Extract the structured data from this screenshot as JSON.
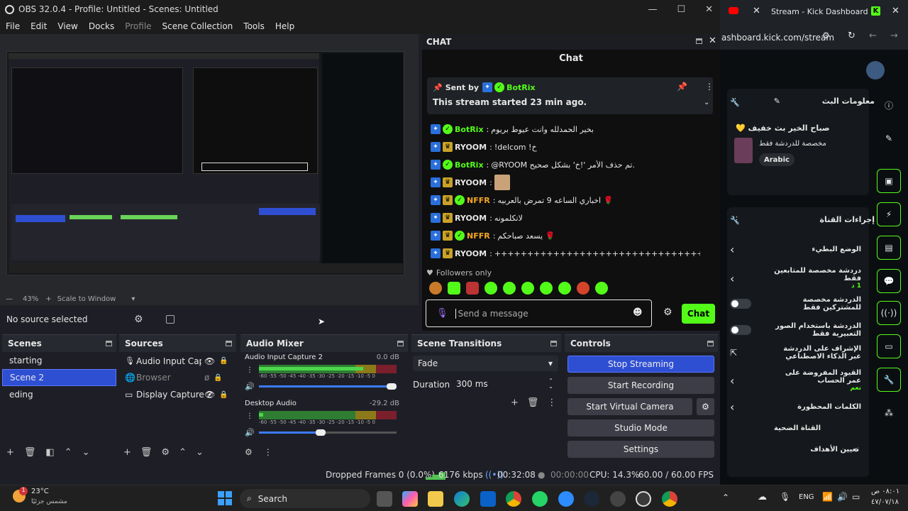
{
  "obs": {
    "title": "OBS 32.0.4 - Profile: Untitled - Scenes: Untitled",
    "menu": [
      "File",
      "Edit",
      "View",
      "Docks",
      "Profile",
      "Scene Collection",
      "Tools",
      "Help"
    ],
    "zoom": "43%",
    "scale_mode": "Scale to Window",
    "no_source": "No source selected",
    "scenes": {
      "title": "Scenes",
      "items": [
        "starting",
        "Scene 2",
        "eding"
      ],
      "selected_index": 1
    },
    "sources": {
      "title": "Sources",
      "items": [
        "Audio Input Captu",
        "Browser",
        "Display Capture 2"
      ]
    },
    "mixer": {
      "title": "Audio Mixer",
      "channels": [
        {
          "name": "Audio Input Capture 2",
          "db": "0.0 dB",
          "ticks": "-60 -55 -50 -45 -40 -35 -30 -25 -20 -15 -10 -5 0",
          "volume": 1.0
        },
        {
          "name": "Desktop Audio",
          "db": "-29.2 dB",
          "ticks": "-60 -55 -50 -45 -40 -35 -30 -25 -20 -15 -10 -5 0",
          "volume": 0.45
        }
      ]
    },
    "transitions": {
      "title": "Scene Transitions",
      "selected": "Fade",
      "duration_label": "Duration",
      "duration_value": "300 ms"
    },
    "controls": {
      "title": "Controls",
      "buttons": [
        "Stop Streaming",
        "Start Recording",
        "Start Virtual Camera",
        "Studio Mode",
        "Settings"
      ]
    },
    "status": {
      "dropped": "Dropped Frames 0 (0.0%)",
      "bitrate": "6176 kbps",
      "stream_time": "00:32:08",
      "rec_time": "00:00:00",
      "cpu": "CPU: 14.3%",
      "fps": "60.00 / 60.00 FPS"
    }
  },
  "chat": {
    "dock_title": "CHAT",
    "header": "Chat",
    "pinned": {
      "sent_by_label": "Sent by",
      "user": "BotRix",
      "text": "This stream started 23 min ago."
    },
    "messages": [
      {
        "user": "BotRix",
        "text": "بخير الحمدلله وانت عيوط بريوم",
        "color": "#53fc18",
        "badges": [
          "blue",
          "green"
        ]
      },
      {
        "user": "RYOOM",
        "text": "!delcom !خ",
        "color": "#e6e6e6",
        "badges": [
          "blue",
          "gold"
        ]
      },
      {
        "user": "BotRix",
        "text": "@RYOOM تم حذف الأمر '!خ' بشكل صحيح.",
        "color": "#53fc18",
        "badges": [
          "blue",
          "green"
        ]
      },
      {
        "user": "RYOOM",
        "text": "",
        "color": "#e6e6e6",
        "badges": [
          "blue",
          "gold"
        ],
        "image": true
      },
      {
        "user": "NFFR",
        "text": "اخباري الساعه 9 تمرض بالعربيه 🌹",
        "color": "#f5a623",
        "badges": [
          "blue",
          "gold",
          "green"
        ]
      },
      {
        "user": "RYOOM",
        "text": "لاتكلمونه",
        "color": "#e6e6e6",
        "badges": [
          "blue",
          "gold"
        ]
      },
      {
        "user": "NFFR",
        "text": "يسعد صباحكم 🌹",
        "color": "#f5a623",
        "badges": [
          "blue",
          "gold",
          "green"
        ]
      },
      {
        "user": "RYOOM",
        "text": "+++++++++++++++++++++++++++++++++++++++++++++++++++++++++++++",
        "color": "#e6e6e6",
        "badges": [
          "blue",
          "gold"
        ]
      }
    ],
    "followers_only": "Followers only",
    "input_placeholder": "Send a message",
    "send_label": "Chat"
  },
  "browser": {
    "tab_title": "Stream - Kick Dashboard",
    "url": "ashboard.kick.com/stream",
    "stream_info_title": "معلومات البث",
    "stream_title": "صباح الخير بث خفيف 💛",
    "stream_category": "مخصصة للدردشة فقط",
    "language": "Arabic",
    "channel_actions_title": "إجراءات القناة",
    "items": [
      {
        "label": "الوضع البطيء",
        "sub": "",
        "control": "chevron"
      },
      {
        "label": "دردشة مخصصة للمتابعين فقط",
        "sub": "1 د",
        "control": "chevron"
      },
      {
        "label": "الدردشة مخصصة للمشتركين فقط",
        "sub": "",
        "control": "toggle"
      },
      {
        "label": "الدردشة باستخدام الصور التعبيرية فقط",
        "sub": "",
        "control": "toggle"
      },
      {
        "label": "الإشراف على الدردشة عبر الذكاء الاصطناعي",
        "sub": "",
        "control": "external"
      },
      {
        "label": "القيود المفروضة على عمر الحساب",
        "sub": "نعم",
        "control": "chevron"
      },
      {
        "label": "الكلمات المحظورة",
        "sub": "",
        "control": "chevron"
      }
    ],
    "target_channel": "القناة الضحية",
    "goals": "تعيين الأهداف"
  },
  "taskbar": {
    "weather_temp": "23°C",
    "weather_desc": "مشمس جزئيًا",
    "weather_badge": "1",
    "search": "Search",
    "lang": "ENG",
    "time": "٠٨:٠١ ص",
    "date": "٤٧/٠٧/١٨"
  },
  "colors": {
    "kick_green": "#53fc18",
    "obs_selected": "#2f4fd3",
    "obs_panel": "#1e1f26"
  }
}
